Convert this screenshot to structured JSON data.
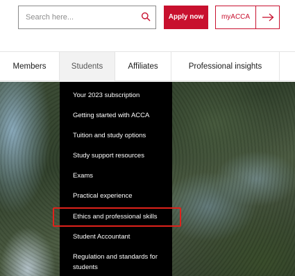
{
  "header": {
    "search": {
      "placeholder": "Search here...",
      "value": ""
    },
    "apply_label": "Apply now",
    "myacca_label": "myACCA",
    "brand_color": "#c8102e",
    "icons": {
      "search": "search-icon",
      "myacca_arrow": "arrow-right-icon"
    }
  },
  "nav": {
    "items": [
      {
        "label": "Members"
      },
      {
        "label": "Students",
        "active": true
      },
      {
        "label": "Affiliates"
      },
      {
        "label": "Professional insights"
      }
    ]
  },
  "dropdown": {
    "items": [
      {
        "label": "Your 2023 subscription"
      },
      {
        "label": "Getting started with ACCA"
      },
      {
        "label": "Tuition and study options"
      },
      {
        "label": "Study support resources"
      },
      {
        "label": "Exams"
      },
      {
        "label": "Practical experience"
      },
      {
        "label": "Ethics and professional skills",
        "highlighted": true
      },
      {
        "label": "Student Accountant"
      },
      {
        "label": "Regulation and standards for students"
      }
    ],
    "highlight_color": "#e0221b"
  }
}
